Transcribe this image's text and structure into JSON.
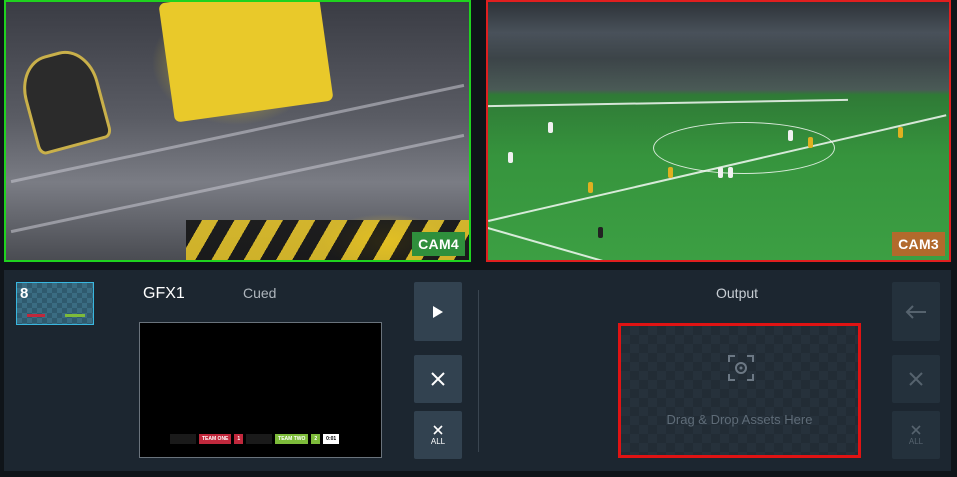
{
  "cameras": [
    {
      "id": "cam4",
      "label": "CAM4",
      "border_color": "#1fd21f"
    },
    {
      "id": "cam3",
      "label": "CAM3",
      "border_color": "#e01f1f"
    }
  ],
  "graphic": {
    "thumbnail_number": "8",
    "title": "GFX1",
    "status": "Cued",
    "scorebug": {
      "team_one": "TEAM ONE",
      "team_one_score": "1",
      "team_two": "TEAM TWO",
      "team_two_score": "2",
      "clock": "0:01"
    }
  },
  "controls": {
    "play_icon": "play-icon",
    "clear_icon": "close-icon",
    "clear_all_label": "ALL"
  },
  "output": {
    "title": "Output",
    "dropzone_text": "Drag & Drop Assets Here",
    "dropzone_icon": "capture-icon",
    "take_icon": "arrow-left-icon",
    "clear_all_label": "ALL"
  },
  "colors": {
    "program_red": "#e01f1f",
    "preview_green": "#1fd21f",
    "panel_bg": "#1c2630",
    "button_bg": "#324250"
  }
}
